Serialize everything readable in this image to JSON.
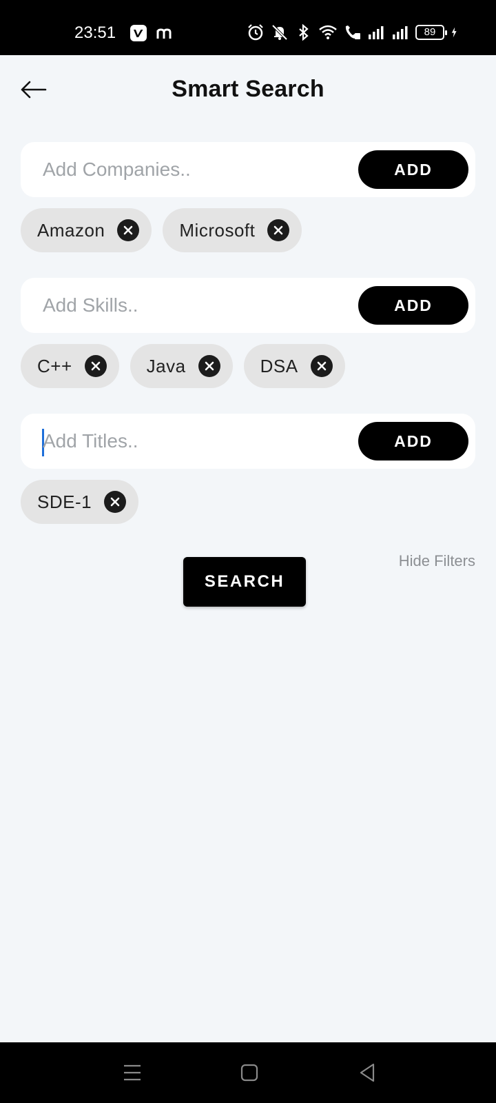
{
  "status_bar": {
    "time": "23:51",
    "battery": "89",
    "app_icons": [
      "vimeo-icon",
      "m-app-icon"
    ],
    "system_icons": [
      "alarm-icon",
      "muted-bell-icon",
      "bluetooth-icon",
      "wifi-icon",
      "wifi-call-icon",
      "signal-icon",
      "signal-icon",
      "battery-icon",
      "charging-icon"
    ]
  },
  "header": {
    "title": "Smart Search",
    "back_icon": "arrow-left-icon"
  },
  "companies": {
    "placeholder": "Add Companies..",
    "add_label": "ADD",
    "chips": [
      "Amazon",
      "Microsoft"
    ]
  },
  "skills": {
    "placeholder": "Add Skills..",
    "add_label": "ADD",
    "chips": [
      "C++",
      "Java",
      "DSA"
    ]
  },
  "titles": {
    "placeholder": "Add Titles..",
    "add_label": "ADD",
    "chips": [
      "SDE-1"
    ]
  },
  "actions": {
    "hide_filters": "Hide Filters",
    "search": "SEARCH"
  },
  "colors": {
    "background": "#f3f6f9",
    "accent": "#000000",
    "chip": "#e4e4e4",
    "caret": "#1e6fd9"
  }
}
